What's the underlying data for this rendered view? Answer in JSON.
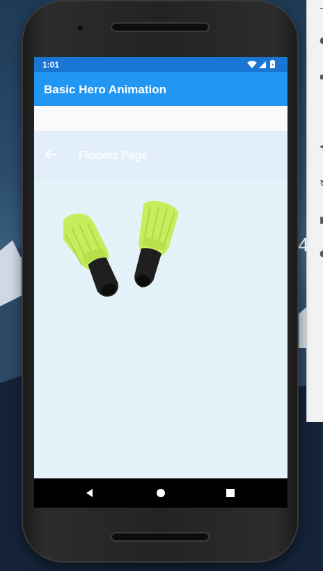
{
  "status_bar": {
    "time": "1:01",
    "bg": "#1976d2"
  },
  "app_bar": {
    "title": "Basic Hero Animation",
    "bg": "#2196f3"
  },
  "hero_page": {
    "title": "Flippers Page",
    "back_icon": "arrow-back-icon"
  },
  "image": {
    "subject": "flippers-image"
  },
  "nav_bar": {
    "icons": [
      "back-triangle-icon",
      "home-circle-icon",
      "overview-square-icon"
    ]
  },
  "side_panel": {
    "letter": "4"
  }
}
